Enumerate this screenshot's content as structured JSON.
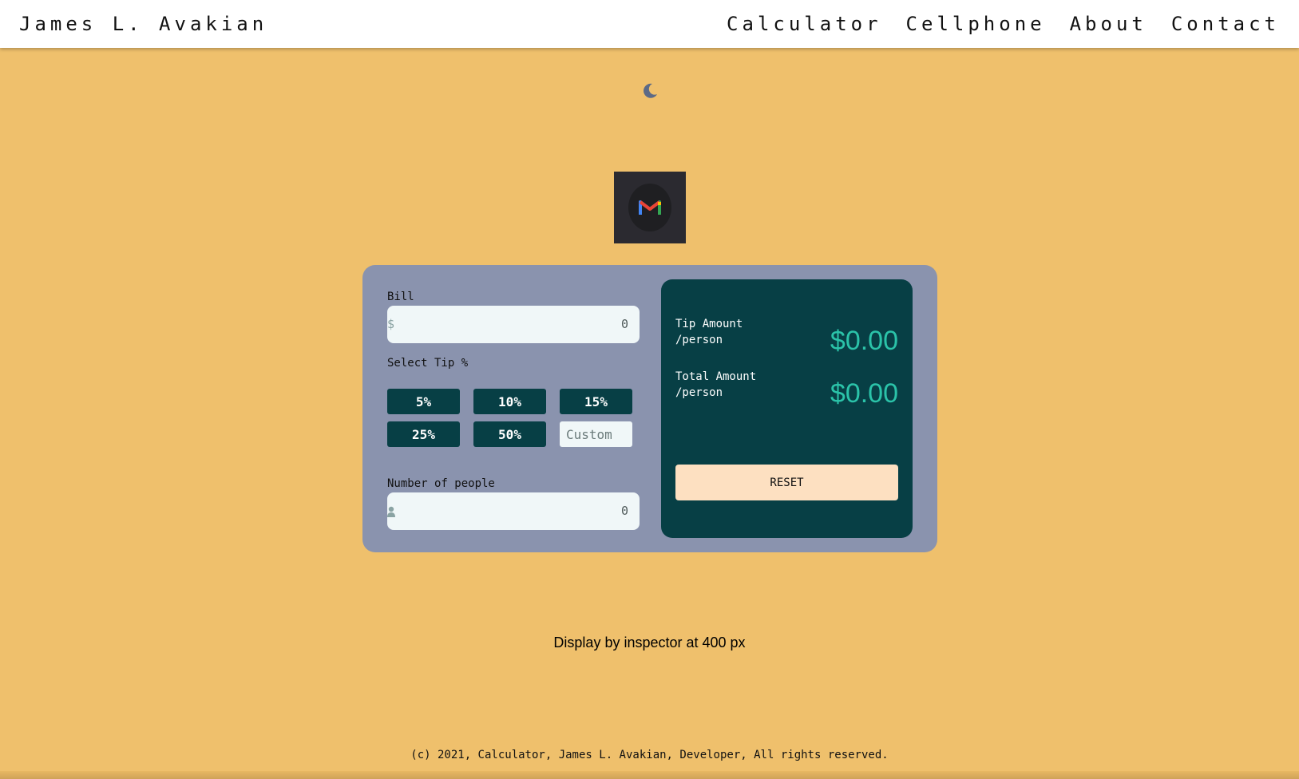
{
  "header": {
    "brand": "James L. Avakian",
    "nav": [
      "Calculator",
      "Cellphone",
      "About",
      "Contact"
    ]
  },
  "theme_toggle_icon": "moon-icon",
  "logo_icon": "gmail-icon",
  "calculator": {
    "bill_label": "Bill",
    "bill_prefix": "$",
    "bill_value": "0",
    "tip_label": "Select Tip %",
    "tips": [
      "5%",
      "10%",
      "15%",
      "25%",
      "50%"
    ],
    "custom_placeholder": "Custom",
    "people_label": "Number of people",
    "people_value": "0",
    "tip_amount_label_1": "Tip Amount",
    "tip_amount_label_2": "/person",
    "tip_amount_value": "$0.00",
    "total_label_1": "Total Amount",
    "total_label_2": "/person",
    "total_value": "$0.00",
    "reset_label": "RESET"
  },
  "inspector_note": "Display by inspector at 400 px",
  "footer": "(c) 2021, Calculator, James L. Avakian, Developer, All rights reserved.",
  "colors": {
    "background": "#efc06c",
    "card": "#8a93ae",
    "dark_teal": "#073f45",
    "accent": "#2bc3a9",
    "reset": "#fde0c1"
  }
}
